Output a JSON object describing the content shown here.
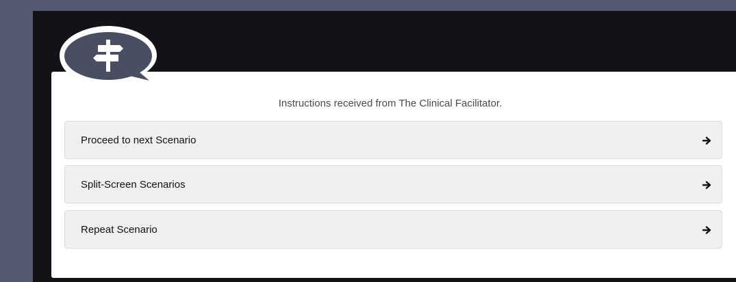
{
  "modal": {
    "subtitle": "Instructions received from The Clinical Facilitator."
  },
  "options": [
    {
      "label": "Proceed to next Scenario",
      "icon": "arrow-right-icon"
    },
    {
      "label": "Split-Screen Scenarios",
      "icon": "arrow-right-icon"
    },
    {
      "label": "Repeat Scenario",
      "icon": "arrow-right-icon"
    }
  ],
  "logo": {
    "icon": "signpost-icon"
  },
  "colors": {
    "outer_background": "#545a72",
    "panel_background": "#121318",
    "modal_background": "#ffffff",
    "option_background": "#f0f0f0",
    "bubble_fill": "#4a4e62"
  }
}
